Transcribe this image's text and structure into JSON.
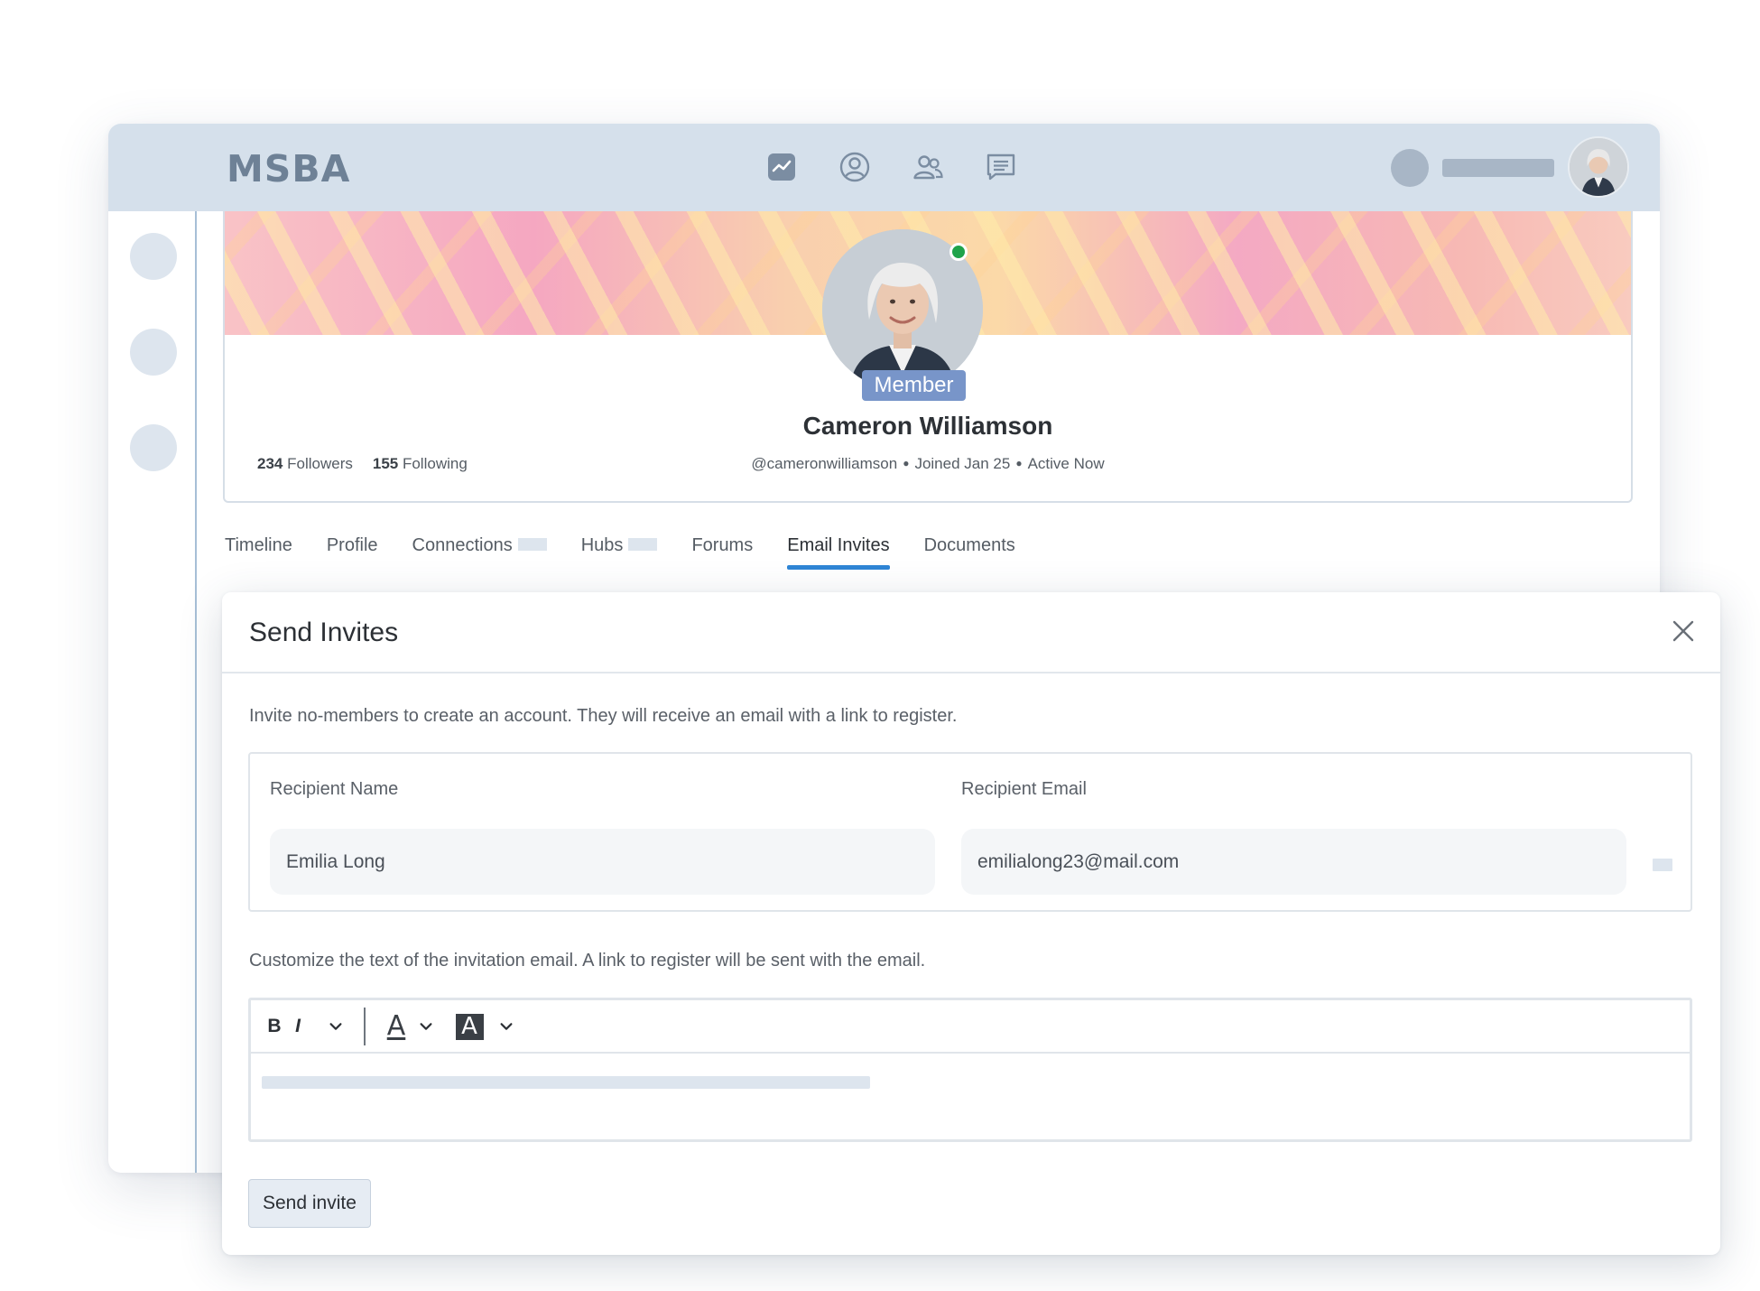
{
  "app": {
    "logo": "MSBA"
  },
  "nav": {
    "icons": [
      "activity-icon",
      "profile-icon",
      "members-icon",
      "messages-icon"
    ]
  },
  "profile": {
    "badge": "Member",
    "name": "Cameron Williamson",
    "followers_count": "234",
    "followers_label": "Followers",
    "following_count": "155",
    "following_label": "Following",
    "handle": "@cameronwilliamson",
    "joined": "Joined Jan 25",
    "status": "Active Now",
    "online": true
  },
  "tabs": [
    {
      "label": "Timeline",
      "active": false
    },
    {
      "label": "Profile",
      "active": false
    },
    {
      "label": "Connections",
      "active": false
    },
    {
      "label": "Hubs",
      "active": false
    },
    {
      "label": "Forums",
      "active": false
    },
    {
      "label": "Email Invites",
      "active": true
    },
    {
      "label": "Documents",
      "active": false
    }
  ],
  "modal": {
    "title": "Send Invites",
    "intro": "Invite no-members to create an account. They will receive an email with a link to register.",
    "recipient_name_label": "Recipient Name",
    "recipient_name_value": "Emilia Long",
    "recipient_email_label": "Recipient Email",
    "recipient_email_value": "emilialong23@mail.com",
    "customize_text": "Customize the text of the invitation email. A link to register will be sent with the email.",
    "toolbar": {
      "bold": "B",
      "italic": "I",
      "font_color": "A",
      "highlight": "A"
    },
    "send_button": "Send invite"
  },
  "colors": {
    "topbar": "#d5e0eb",
    "accent": "#2f86d6",
    "badge": "#7895c9",
    "online": "#1fa34a"
  }
}
